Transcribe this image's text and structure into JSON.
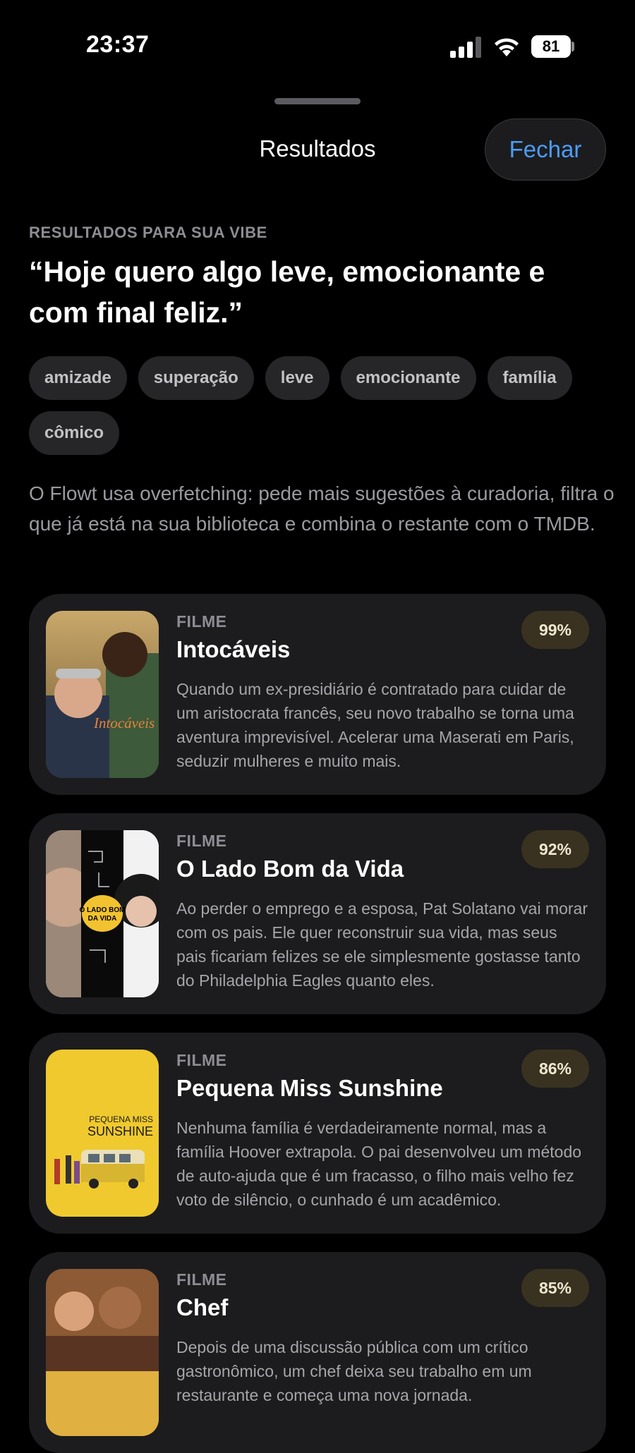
{
  "status_bar": {
    "time": "23:37",
    "battery": "81"
  },
  "nav": {
    "title": "Resultados",
    "close_label": "Fechar"
  },
  "header": {
    "kicker": "RESULTADOS PARA SUA VIBE",
    "prompt": "“Hoje quero algo leve, emocionante e com final feliz.”"
  },
  "tags": [
    "amizade",
    "superação",
    "leve",
    "emocionante",
    "família",
    "cômico"
  ],
  "description": "O Flowt usa overfetching: pede mais sugestões à curadoria, filtra o que já está na sua biblioteca e combina o restante com o TMDB.",
  "results": [
    {
      "kind": "FILME",
      "title": "Intocáveis",
      "match": "99%",
      "synopsis": "Quando um ex-presidiário é contratado para cuidar de um aristocrata francês, seu novo trabalho se torna uma aventura imprevisível. Acelerar uma Maserati em Paris, seduzir mulheres e muito mais.",
      "poster_text": "Intocáveis"
    },
    {
      "kind": "FILME",
      "title": "O Lado Bom da Vida",
      "match": "92%",
      "synopsis": "Ao perder o emprego e a esposa, Pat Solatano vai morar com os pais. Ele quer reconstruir sua vida, mas seus pais ficariam felizes se ele simplesmente gostasse tanto do Philadelphia Eagles quanto eles.",
      "poster_text_1": "O LADO BOM",
      "poster_text_2": "DA VIDA"
    },
    {
      "kind": "FILME",
      "title": "Pequena Miss Sunshine",
      "match": "86%",
      "synopsis": "Nenhuma família é verdadeiramente normal, mas a família Hoover extrapola. O pai desenvolveu um método de auto-ajuda que é um fracasso, o filho mais velho fez voto de silêncio, o cunhado é um acadêmico.",
      "poster_text_1": "PEQUENA MISS",
      "poster_text_2": "SUNSHINE"
    },
    {
      "kind": "FILME",
      "title": "Chef",
      "match": "85%",
      "synopsis": "Depois de uma discussão pública com um crítico gastronômico, um chef deixa seu trabalho em um restaurante e começa uma nova jornada."
    }
  ]
}
